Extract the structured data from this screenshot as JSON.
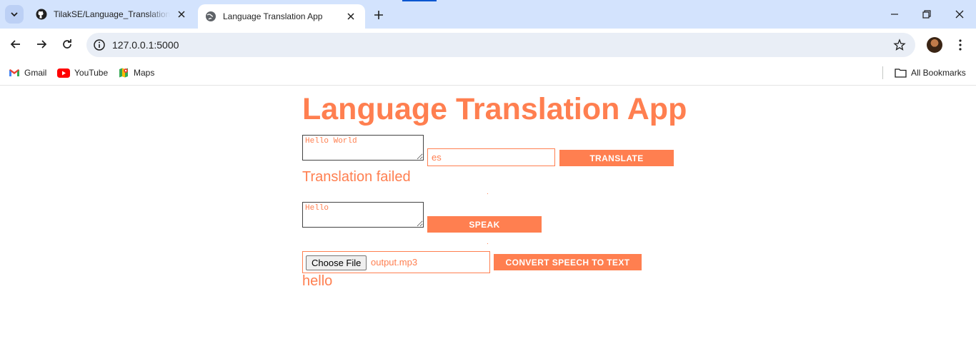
{
  "browser": {
    "tabs": [
      {
        "title": "TilakSE/Language_Translation_App",
        "active": false
      },
      {
        "title": "Language Translation App",
        "active": true
      }
    ],
    "url": "127.0.0.1:5000",
    "bookmarks": [
      {
        "label": "Gmail",
        "icon": "gmail-icon"
      },
      {
        "label": "YouTube",
        "icon": "youtube-icon"
      },
      {
        "label": "Maps",
        "icon": "maps-icon"
      }
    ],
    "all_bookmarks_label": "All Bookmarks"
  },
  "app": {
    "title": "Language Translation App",
    "translate_section": {
      "source_text": "Hello World",
      "target_language": "es",
      "button_label": "TRANSLATE",
      "result": "Translation failed"
    },
    "speak_section": {
      "text": "Hello",
      "button_label": "SPEAK"
    },
    "speech_to_text_section": {
      "file_button_label": "Choose File",
      "file_name": "output.mp3",
      "button_label": "CONVERT SPEECH TO TEXT",
      "result": "hello"
    }
  },
  "colors": {
    "accent": "#ff7f50",
    "tabstrip": "#d3e3fd",
    "omnibox": "#e9eef6"
  }
}
